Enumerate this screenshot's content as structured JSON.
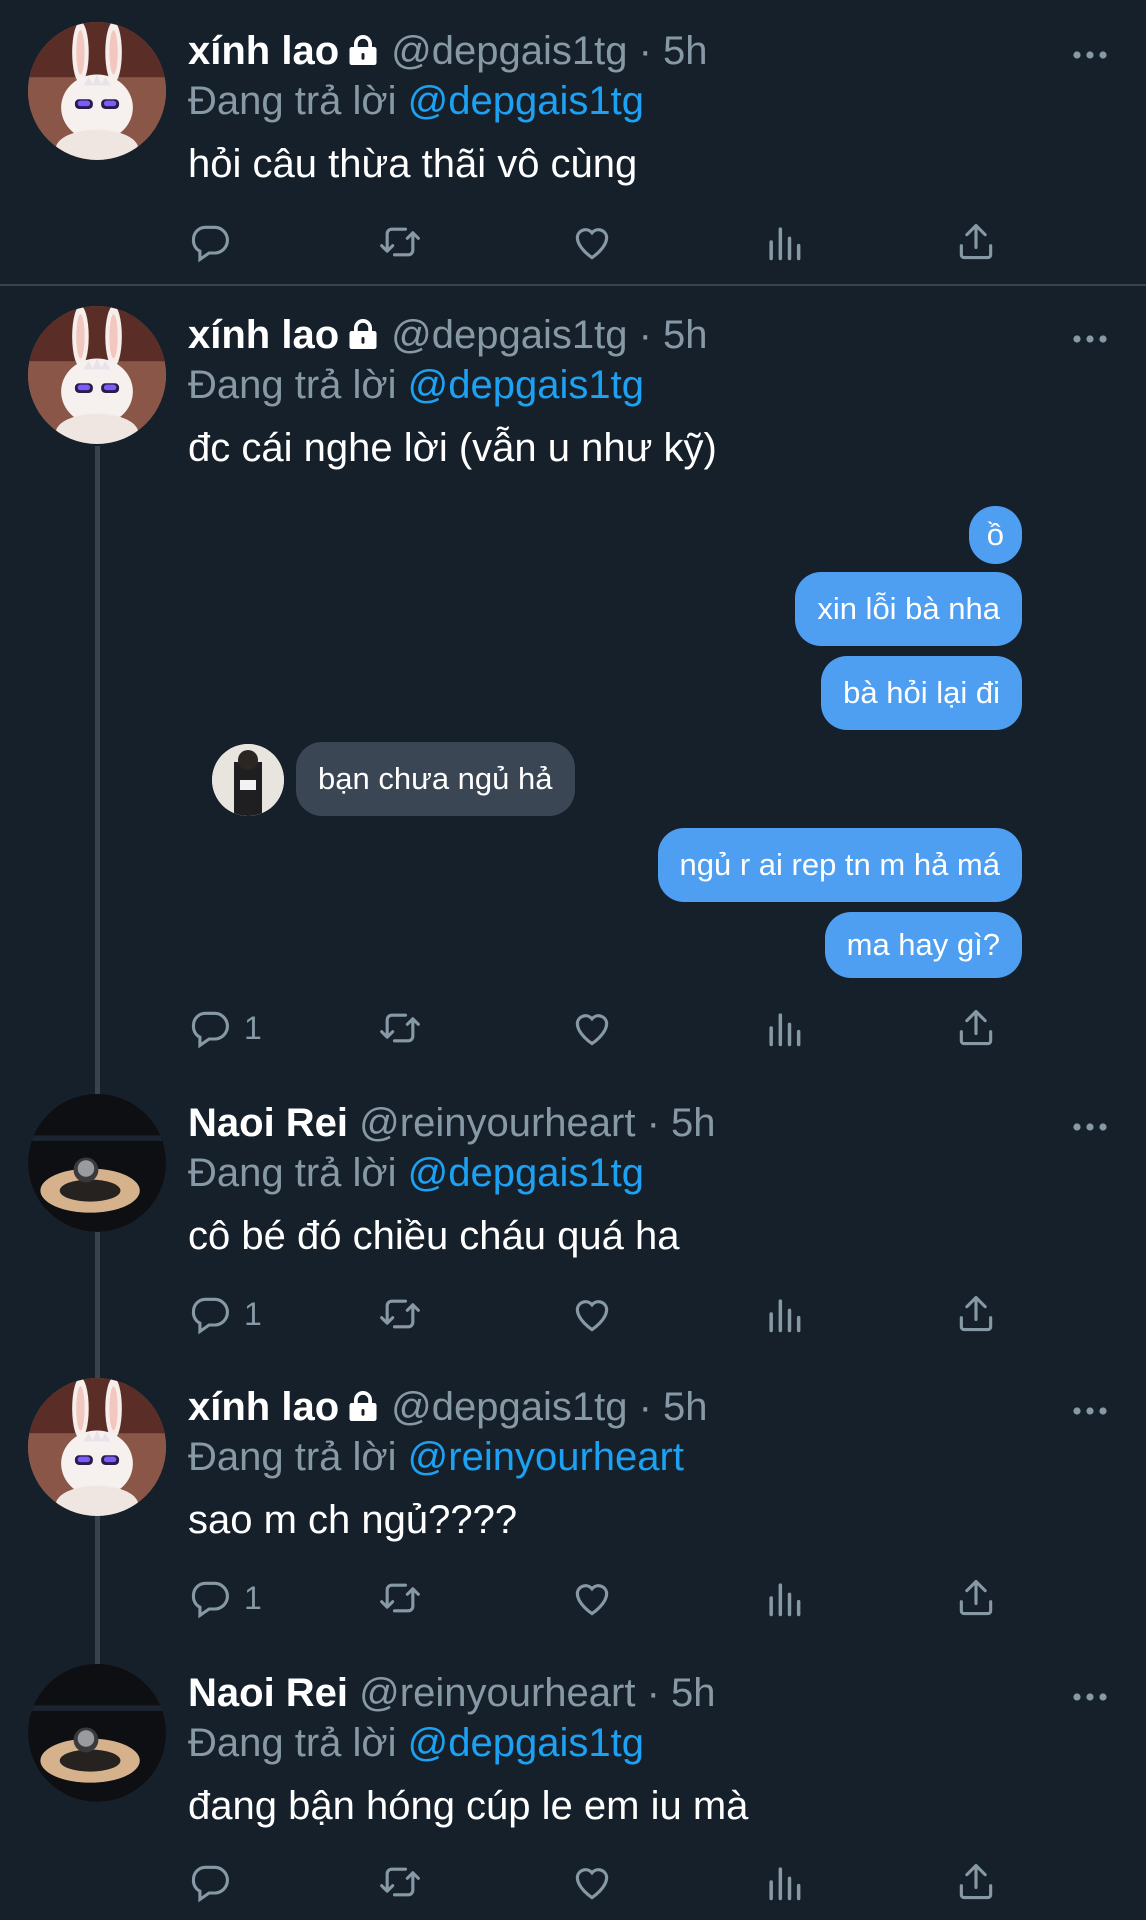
{
  "colors": {
    "background": "#15202b",
    "link": "#1da1f2",
    "muted": "#8899a6",
    "bubble_blue": "#4e9ff2",
    "bubble_gray": "#3b4654"
  },
  "tweets": [
    {
      "name": "xính lao",
      "locked": true,
      "handle": "@depgais1tg",
      "time": "5h",
      "replying_prefix": "Đang trả lời",
      "replying_to": "@depgais1tg",
      "text": "hỏi câu thừa thãi vô cùng",
      "reply_count": "",
      "avatar": "bunny-avatar"
    },
    {
      "name": "xính lao",
      "locked": true,
      "handle": "@depgais1tg",
      "time": "5h",
      "replying_prefix": "Đang trả lời",
      "replying_to": "@depgais1tg",
      "text": "đc cái nghe lời (vẫn u như kỹ)",
      "reply_count": "1",
      "avatar": "bunny-avatar",
      "media_chat": {
        "messages": [
          {
            "from": "me",
            "text": "ồ"
          },
          {
            "from": "me",
            "text": "xin lỗi bà nha"
          },
          {
            "from": "me",
            "text": "bà hỏi lại đi"
          },
          {
            "from": "them",
            "text": "bạn chưa ngủ hả"
          },
          {
            "from": "me",
            "text": "ngủ r ai rep tn m hả má"
          },
          {
            "from": "me",
            "text": "ma hay gì?"
          }
        ]
      }
    },
    {
      "name": "Naoi Rei",
      "locked": false,
      "handle": "@reinyourheart",
      "time": "5h",
      "replying_prefix": "Đang trả lời",
      "replying_to": "@depgais1tg",
      "text": "cô bé đó chiều cháu quá ha",
      "reply_count": "1",
      "avatar": "night-pool-avatar"
    },
    {
      "name": "xính lao",
      "locked": true,
      "handle": "@depgais1tg",
      "time": "5h",
      "replying_prefix": "Đang trả lời",
      "replying_to": "@reinyourheart",
      "text": "sao m ch ngủ????",
      "reply_count": "1",
      "avatar": "bunny-avatar"
    },
    {
      "name": "Naoi Rei",
      "locked": false,
      "handle": "@reinyourheart",
      "time": "5h",
      "replying_prefix": "Đang trả lời",
      "replying_to": "@depgais1tg",
      "text": "đang bận hóng cúp le em iu mà",
      "reply_count": "",
      "avatar": "night-pool-avatar"
    }
  ],
  "separator": "·"
}
